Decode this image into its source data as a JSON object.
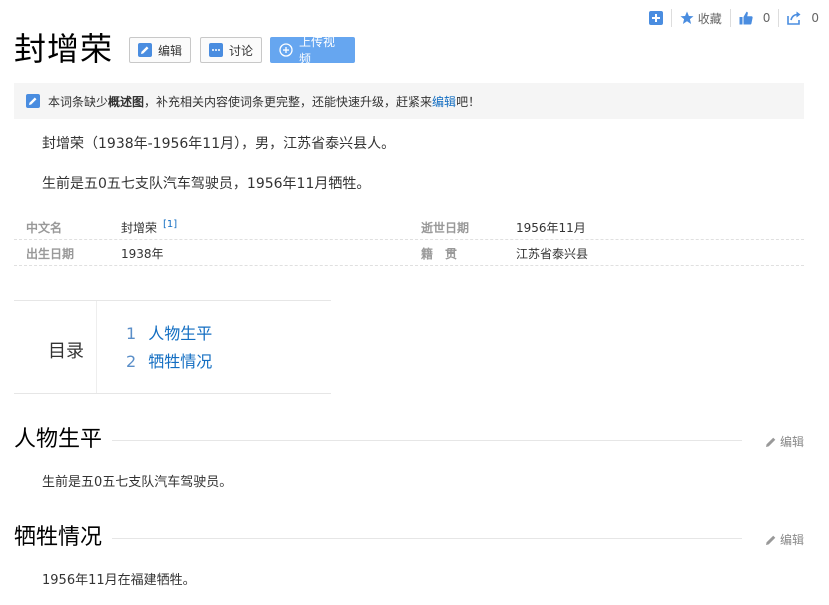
{
  "topbar": {
    "add_icon": "plus-square-icon",
    "favorite_label": "收藏",
    "like_count": "0",
    "share_count": "0"
  },
  "title": "封增荣",
  "buttons": {
    "edit": "编辑",
    "discuss": "讨论",
    "upload_video": "上传视频"
  },
  "notice": {
    "part1": "本词条缺少",
    "bold": "概述图",
    "part2": "，补充相关内容使词条更完整，还能快速升级，赶紧来",
    "link": "编辑",
    "part3": "吧！"
  },
  "summary": [
    "封增荣（1938年-1956年11月），男，江苏省泰兴县人。",
    "生前是五0五七支队汽车驾驶员，1956年11月牺牲。"
  ],
  "basic_info": {
    "name_key": "中文名",
    "name_val": "封增荣",
    "name_ref": "[1]",
    "death_key": "逝世日期",
    "death_val": "1956年11月",
    "birth_key": "出生日期",
    "birth_val": "1938年",
    "origin_key": "籍　贯",
    "origin_val": "江苏省泰兴县"
  },
  "toc": {
    "title": "目录",
    "items": [
      {
        "num": "1",
        "label": "人物生平"
      },
      {
        "num": "2",
        "label": "牺牲情况"
      }
    ]
  },
  "sections": [
    {
      "title": "人物生平",
      "edit": "编辑",
      "text": "生前是五0五七支队汽车驾驶员。"
    },
    {
      "title": "牺牲情况",
      "edit": "编辑",
      "text": "1956年11月在福建牺牲。"
    }
  ],
  "colors": {
    "link": "#136ec2",
    "primary_button": "#66a6f0",
    "icon_blue": "#4a8de0"
  }
}
